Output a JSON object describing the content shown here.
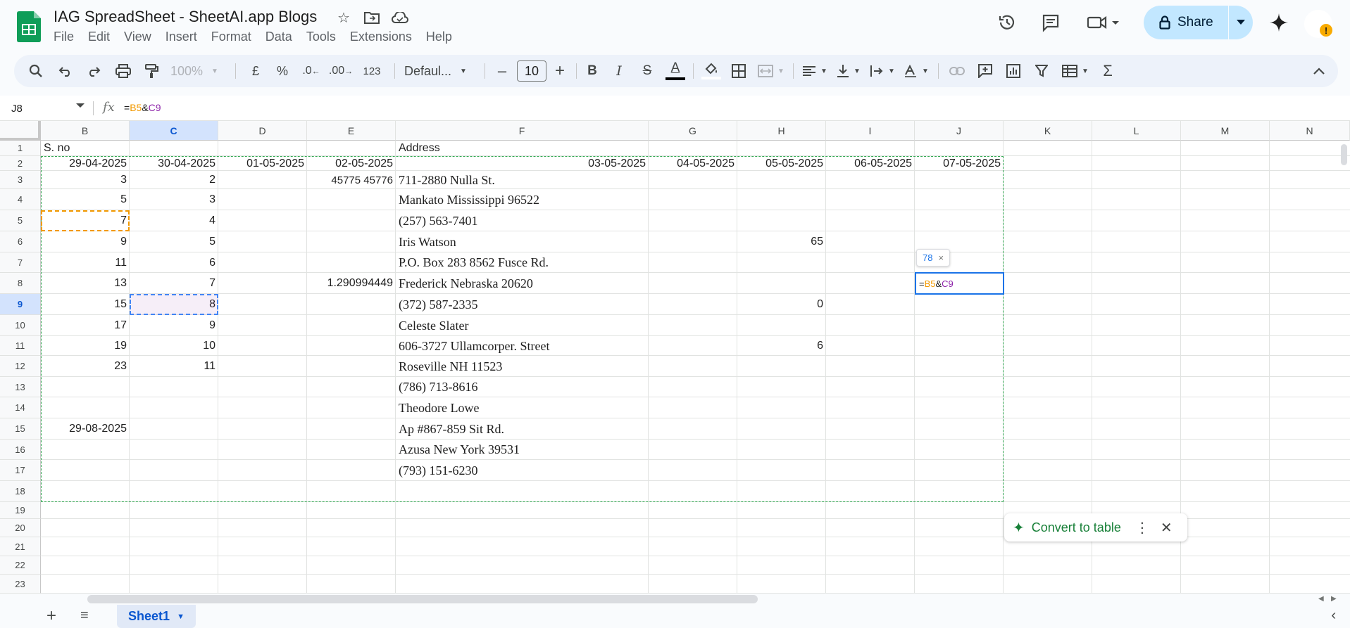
{
  "app": {
    "title": "IAG SpreadSheet - SheetAI.app Blogs",
    "menu": [
      "File",
      "Edit",
      "View",
      "Insert",
      "Format",
      "Data",
      "Tools",
      "Extensions",
      "Help"
    ],
    "share_label": "Share"
  },
  "toolbar": {
    "zoom": "100%",
    "currency": "£",
    "percent": "%",
    "dec_less": ".0",
    "dec_more": ".00",
    "number_format": "123",
    "font": "Defaul...",
    "font_size": "10",
    "font_minus": "–",
    "font_plus": "+",
    "bold": "B",
    "italic": "I",
    "strike": "S",
    "text_color": "A",
    "sum": "Σ"
  },
  "formula_bar": {
    "name_box": "J8",
    "fx": "fx",
    "formula_eq": "=",
    "formula_ref1": "B5",
    "formula_amp": "&",
    "formula_ref2": "C9"
  },
  "columns": [
    "B",
    "C",
    "D",
    "E",
    "F",
    "G",
    "H",
    "I",
    "J",
    "K",
    "L",
    "M",
    "N"
  ],
  "rows": [
    "1",
    "2",
    "3",
    "4",
    "5",
    "6",
    "7",
    "8",
    "9",
    "10",
    "11",
    "12",
    "13",
    "14",
    "15",
    "16",
    "17",
    "18",
    "19",
    "20",
    "21",
    "22",
    "23"
  ],
  "cells": {
    "B1": "S. no",
    "F1": "Address",
    "B2": "29-04-2025",
    "C2": "30-04-2025",
    "D2": "01-05-2025",
    "E2": "02-05-2025",
    "F2": "03-05-2025",
    "G2": "04-05-2025",
    "H2": "05-05-2025",
    "I2": "06-05-2025",
    "J2": "07-05-2025",
    "B3": "3",
    "C3": "2",
    "E3": "45775 45776",
    "F3": "711-2880 Nulla St.",
    "B4": "5",
    "C4": "3",
    "F4": "Mankato Mississippi 96522",
    "B5": "7",
    "C5": "4",
    "F5": "(257) 563-7401",
    "B6": "9",
    "C6": "5",
    "F6": "Iris Watson",
    "H6": "65",
    "B7": "11",
    "C7": "6",
    "F7": "P.O. Box 283 8562 Fusce Rd.",
    "B8": "13",
    "C8": "7",
    "E8": "1.290994449",
    "F8": "Frederick Nebraska 20620",
    "B9": "15",
    "C9": "8",
    "F9": "(372) 587-2335",
    "H9": "0",
    "B10": "17",
    "C10": "9",
    "F10": "Celeste Slater",
    "B11": "19",
    "C11": "10",
    "F11": "606-3727 Ullamcorper. Street",
    "H11": "6",
    "B12": "23",
    "C12": "11",
    "F12": "Roseville NH 11523",
    "F13": "(786) 713-8616",
    "F14": "Theodore Lowe",
    "B15": "29-08-2025",
    "F15": "Ap #867-859 Sit Rd.",
    "F16": "Azusa New York 39531",
    "F17": "(793) 151-6230"
  },
  "active_cell": {
    "eq": "=",
    "ref1": "B5",
    "amp": "&",
    "ref2": "C9",
    "preview": "78",
    "preview_close": "×"
  },
  "convert_chip": {
    "label": "Convert to table",
    "more": "⋮",
    "close": "✕"
  },
  "sheet_tab": {
    "name": "Sheet1"
  },
  "colors": {
    "accent": "#0b57d0",
    "share_bg": "#c2e7ff",
    "ref1": "#f29900",
    "ref2": "#8e24aa",
    "copy_border": "#34a853"
  }
}
